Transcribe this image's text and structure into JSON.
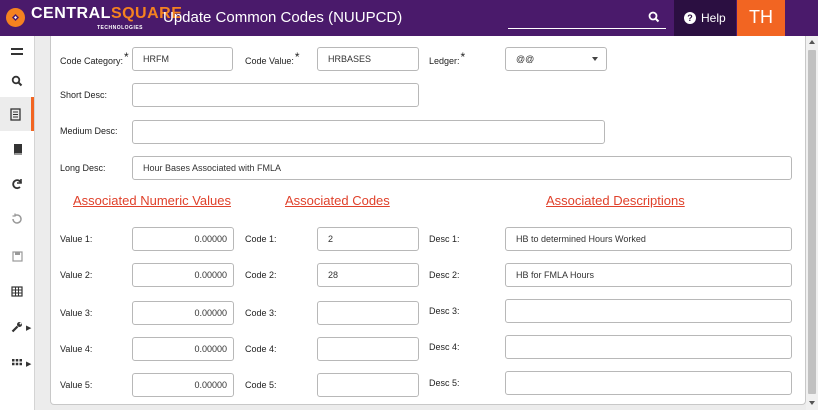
{
  "header": {
    "brand_main": "CENTRAL",
    "brand_accent": "SQUARE",
    "brand_sub": "TECHNOLOGIES",
    "page_title": "Update Common Codes (NUUPCD)",
    "help_label": "Help",
    "avatar_initials": "TH"
  },
  "colors": {
    "topbar": "#4a1a6b",
    "accent": "#f26522",
    "section_heading": "#e0412b"
  },
  "sidebar": {
    "icons": [
      "menu-icon",
      "search-icon",
      "document-icon",
      "book-icon",
      "refresh-icon",
      "undo-icon",
      "save-icon",
      "grid-icon",
      "wrench-icon",
      "apps-icon"
    ]
  },
  "form": {
    "code_category_label": "Code Category:",
    "code_category_value": "HRFM",
    "code_value_label": "Code Value:",
    "code_value_value": "HRBASES",
    "ledger_label": "Ledger:",
    "ledger_value": "@@",
    "required_mark": "*",
    "short_desc_label": "Short Desc:",
    "short_desc_value": "",
    "medium_desc_label": "Medium Desc:",
    "medium_desc_value": "",
    "long_desc_label": "Long Desc:",
    "long_desc_value": "Hour Bases Associated with FMLA"
  },
  "sections": {
    "numeric_heading": "Associated Numeric Values",
    "codes_heading": "Associated Codes",
    "descriptions_heading": "Associated Descriptions"
  },
  "rows": [
    {
      "value_label": "Value 1:",
      "value": "0.00000",
      "code_label": "Code 1:",
      "code": "2",
      "desc_label": "Desc 1:",
      "desc": "HB to determined Hours Worked"
    },
    {
      "value_label": "Value 2:",
      "value": "0.00000",
      "code_label": "Code 2:",
      "code": "28",
      "desc_label": "Desc 2:",
      "desc": "HB for FMLA Hours"
    },
    {
      "value_label": "Value 3:",
      "value": "0.00000",
      "code_label": "Code 3:",
      "code": "",
      "desc_label": "Desc 3:",
      "desc": ""
    },
    {
      "value_label": "Value 4:",
      "value": "0.00000",
      "code_label": "Code 4:",
      "code": "",
      "desc_label": "Desc 4:",
      "desc": ""
    },
    {
      "value_label": "Value 5:",
      "value": "0.00000",
      "code_label": "Code 5:",
      "code": "",
      "desc_label": "Desc 5:",
      "desc": ""
    }
  ]
}
